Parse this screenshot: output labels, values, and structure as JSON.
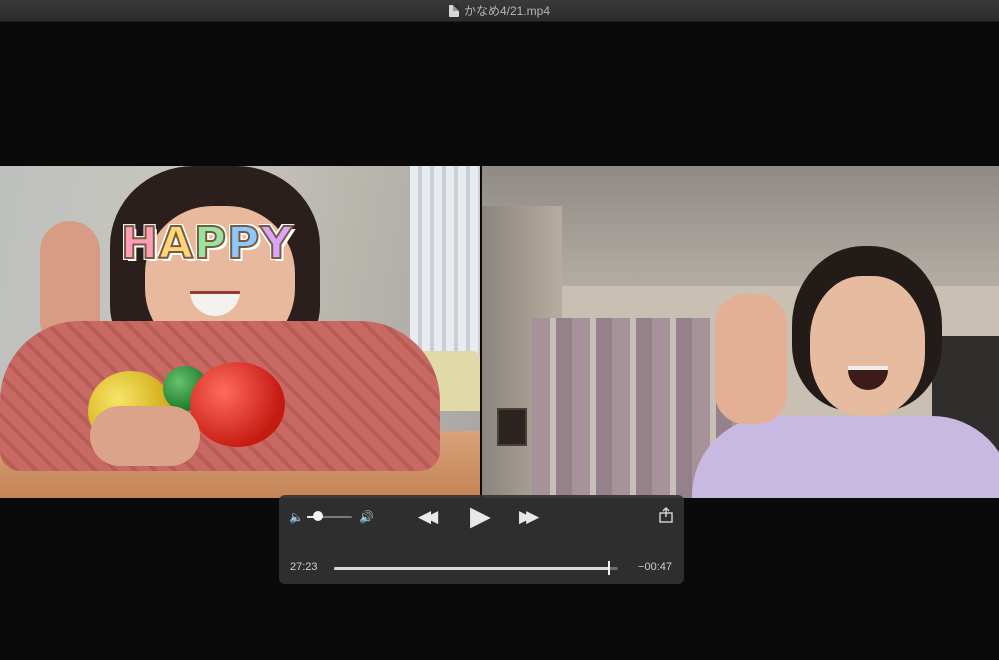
{
  "window": {
    "title": "かなめ4/21.mp4",
    "icon": "document-icon"
  },
  "overlay": {
    "sticker_text": "HAPPY"
  },
  "controls": {
    "volume_low_icon": "speaker-low-icon",
    "volume_high_icon": "speaker-high-icon",
    "volume_level": 0.25,
    "rewind_icon": "rewind-icon",
    "play_icon": "play-icon",
    "fast_forward_icon": "fast-forward-icon",
    "share_icon": "share-icon",
    "time_elapsed": "27:23",
    "time_remaining": "−00:47",
    "progress": 0.97
  }
}
